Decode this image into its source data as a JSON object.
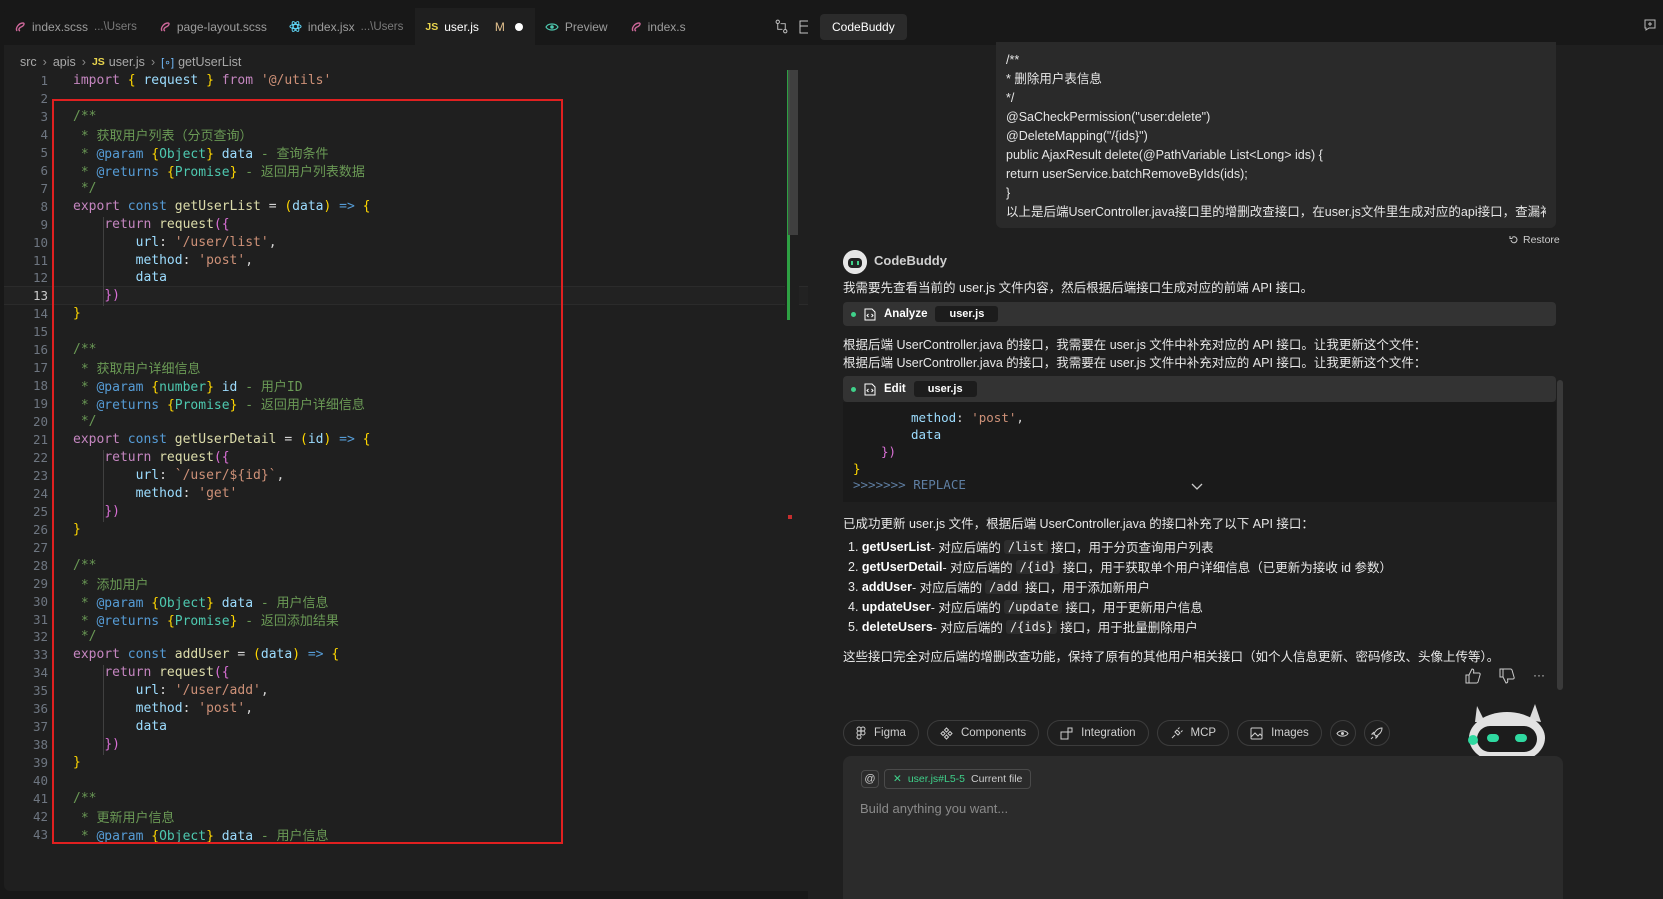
{
  "editor": {
    "tabs": [
      {
        "label": "index.scss",
        "desc": "...\\Users",
        "icon": "sass-file-icon"
      },
      {
        "label": "page-layout.scss",
        "desc": "",
        "icon": "sass-file-icon"
      },
      {
        "label": "index.jsx",
        "desc": "...\\Users",
        "icon": "react-file-icon"
      },
      {
        "label": "user.js",
        "desc": "",
        "status": "M",
        "icon": "js-file-icon"
      },
      {
        "label": "Preview",
        "desc": "",
        "icon": "eye-icon"
      },
      {
        "label": "index.s",
        "desc": "",
        "icon": "sass-file-icon"
      }
    ],
    "js_badge": "JS",
    "breadcrumb": [
      "src",
      "apis",
      "user.js",
      "getUserList"
    ],
    "current_line": 13,
    "line_numbers": [
      "1",
      "2",
      "3",
      "4",
      "5",
      "6",
      "7",
      "8",
      "9",
      "10",
      "11",
      "12",
      "13",
      "14",
      "15",
      "16",
      "17",
      "18",
      "19",
      "20",
      "21",
      "22",
      "23",
      "24",
      "25",
      "26",
      "27",
      "28",
      "29",
      "30",
      "31",
      "32",
      "33",
      "34",
      "35",
      "36",
      "37",
      "38",
      "39",
      "40",
      "41",
      "42",
      "43"
    ],
    "code_lines": [
      "import { request } from '@/utils'",
      "",
      "/**",
      " * 获取用户列表（分页查询）",
      " * @param {Object} data - 查询条件",
      " * @returns {Promise} - 返回用户列表数据",
      " */",
      "export const getUserList = (data) => {",
      "    return request({",
      "        url: '/user/list',",
      "        method: 'post',",
      "        data",
      "    })",
      "}",
      "",
      "/**",
      " * 获取用户详细信息",
      " * @param {number} id - 用户ID",
      " * @returns {Promise} - 返回用户详细信息",
      " */",
      "export const getUserDetail = (id) => {",
      "    return request({",
      "        url: `/user/${id}`,",
      "        method: 'get'",
      "    })",
      "}",
      "",
      "/**",
      " * 添加用户",
      " * @param {Object} data - 用户信息",
      " * @returns {Promise} - 返回添加结果",
      " */",
      "export const addUser = (data) => {",
      "    return request({",
      "        url: '/user/add',",
      "        method: 'post',",
      "        data",
      "    })",
      "}",
      "",
      "/**",
      " * 更新用户信息",
      " * @param {Object} data - 用户信息"
    ]
  },
  "chat": {
    "tab_label": "CodeBuddy",
    "user_message": [
      "/**",
      "* 删除用户表信息",
      "*/",
      "@SaCheckPermission(\"user:delete\")",
      "@DeleteMapping(\"/{ids}\")",
      "public AjaxResult delete(@PathVariable List<Long> ids) {",
      "return userService.batchRemoveByIds(ids);",
      "}",
      "以上是后端UserController.java接口里的增删改查接口，在user.js文件里生成对应的api接口，查漏补缺"
    ],
    "restore_label": "Restore",
    "bot_name": "CodeBuddy",
    "intro": "我需要先查看当前的 user.js 文件内容，然后根据后端接口生成对应的前端 API 接口。",
    "analyze": {
      "label": "Analyze",
      "file": "user.js"
    },
    "explain_1": "根据后端 UserController.java 的接口，我需要在 user.js 文件中补充对应的 API 接口。让我更新这个文件：",
    "explain_2": "根据后端 UserController.java 的接口，我需要在 user.js 文件中补充对应的 API 接口。让我更新这个文件：",
    "edit": {
      "label": "Edit",
      "file": "user.js"
    },
    "edit_code": {
      "method_key": "method",
      "method_value": "'post'",
      "data_line": "data",
      "close_1": "})",
      "close_2": "}",
      "replace_marker": ">>>>>>> REPLACE"
    },
    "summary": "已成功更新 user.js 文件，根据后端 UserController.java 的接口补充了以下 API 接口：",
    "items": [
      {
        "num": "1.",
        "name": "getUserList",
        "pre": " - 对应后端的",
        "code": "/list",
        "post": "接口，用于分页查询用户列表"
      },
      {
        "num": "2.",
        "name": "getUserDetail",
        "pre": " - 对应后端的",
        "code": "/{id}",
        "post": "接口，用于获取单个用户详细信息（已更新为接收 id 参数）"
      },
      {
        "num": "3.",
        "name": "addUser",
        "pre": " - 对应后端的",
        "code": "/add",
        "post": "接口，用于添加新用户"
      },
      {
        "num": "4.",
        "name": "updateUser",
        "pre": " - 对应后端的",
        "code": "/update",
        "post": "接口，用于更新用户信息"
      },
      {
        "num": "5.",
        "name": "deleteUsers",
        "pre": " - 对应后端的",
        "code": "/{ids}",
        "post": "接口，用于批量删除用户"
      }
    ],
    "conclusion": "这些接口完全对应后端的增删改查功能，保持了原有的其他用户相关接口（如个人信息更新、密码修改、头像上传等）。",
    "feedback_more": "···",
    "chips": [
      "Figma",
      "Components",
      "Integration",
      "MCP",
      "Images"
    ],
    "context_file": "user.js#L5-5",
    "context_note": "Current file",
    "at_symbol": "@",
    "input_placeholder": "Build anything you want..."
  },
  "colors": {
    "selection_box": "#e02020",
    "accent_green": "#3fd18a",
    "modified": "#e2c08d"
  }
}
